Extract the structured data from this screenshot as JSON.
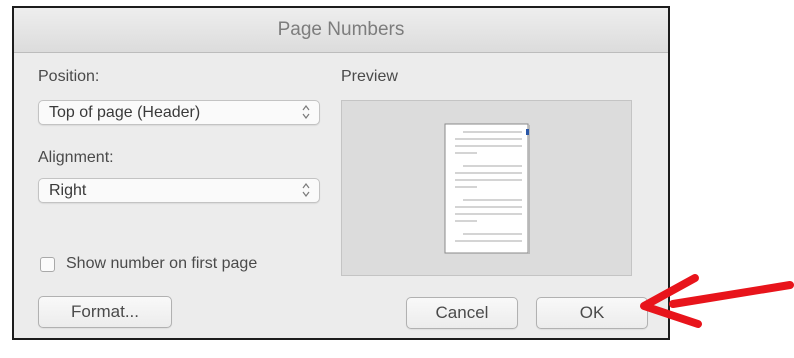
{
  "dialog": {
    "title": "Page Numbers",
    "position": {
      "label": "Position:",
      "value": "Top of page (Header)"
    },
    "alignment": {
      "label": "Alignment:",
      "value": "Right"
    },
    "preview": {
      "label": "Preview"
    },
    "show_first_page": {
      "label": "Show number on first page",
      "checked": false
    },
    "buttons": {
      "format": "Format...",
      "cancel": "Cancel",
      "ok": "OK"
    }
  },
  "annotation": {
    "color": "#e8141b",
    "target": "ok-button"
  }
}
